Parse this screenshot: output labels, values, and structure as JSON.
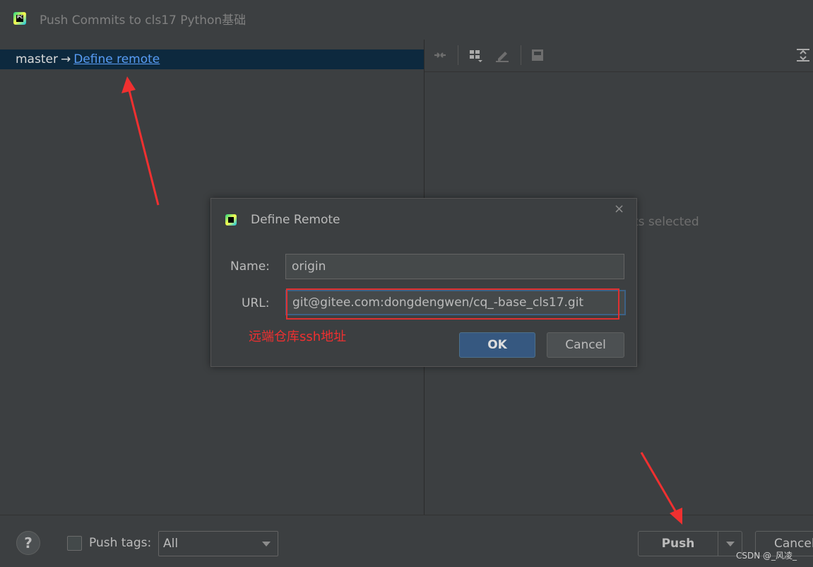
{
  "window": {
    "title": "Push Commits to cls17 Python基础"
  },
  "branch": {
    "name": "master",
    "arrow": "→",
    "define_remote": "Define remote"
  },
  "right_panel": {
    "empty_text": "ts selected"
  },
  "bottom": {
    "help": "?",
    "push_tags_label": "Push tags:",
    "push_tags_value": "All",
    "push_label": "Push",
    "cancel_label": "Cancel",
    "watermark": "CSDN @_风凌_"
  },
  "dialog": {
    "title": "Define Remote",
    "close": "×",
    "name_label": "Name:",
    "name_value": "origin",
    "url_label": "URL:",
    "url_value": "git@gitee.com:dongdengwen/cq_-base_cls17.git",
    "hint": "远端仓库ssh地址",
    "ok_label": "OK",
    "cancel_label": "Cancel"
  },
  "colors": {
    "background": "#3c3f41",
    "selection": "#0d293e",
    "link": "#589df6",
    "primary_button": "#365880",
    "annotation_red": "#e03030"
  },
  "icons": {
    "app": "pycharm-icon",
    "toolbar": [
      "collapse-icon",
      "group-by-icon",
      "edit-icon",
      "save-icon",
      "expand-icon"
    ]
  }
}
